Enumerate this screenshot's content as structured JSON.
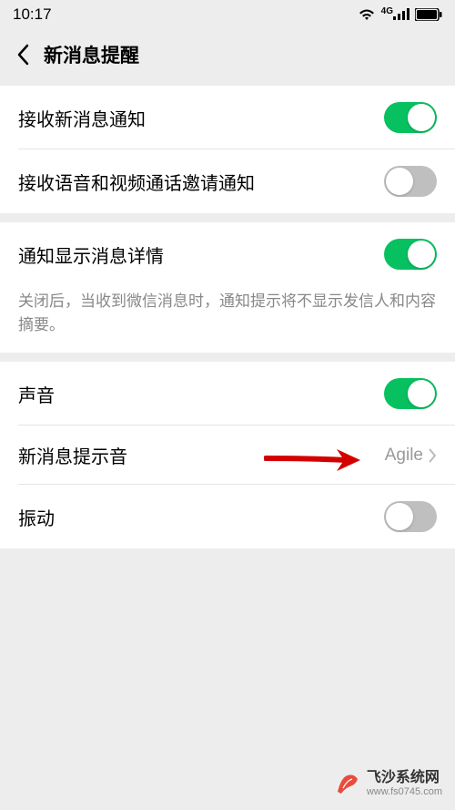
{
  "statusBar": {
    "time": "10:17",
    "signalLabel": "4G"
  },
  "header": {
    "title": "新消息提醒"
  },
  "sections": {
    "receiveNewMsg": "接收新消息通知",
    "receiveVoiceVideo": "接收语音和视频通话邀请通知",
    "showDetail": "通知显示消息详情",
    "showDetailDesc": "关闭后，当收到微信消息时，通知提示将不显示发信人和内容摘要。",
    "sound": "声音",
    "newMsgTone": "新消息提示音",
    "newMsgToneValue": "Agile",
    "vibrate": "振动"
  },
  "watermark": {
    "main": "飞沙系统网",
    "sub": "www.fs0745.com"
  }
}
